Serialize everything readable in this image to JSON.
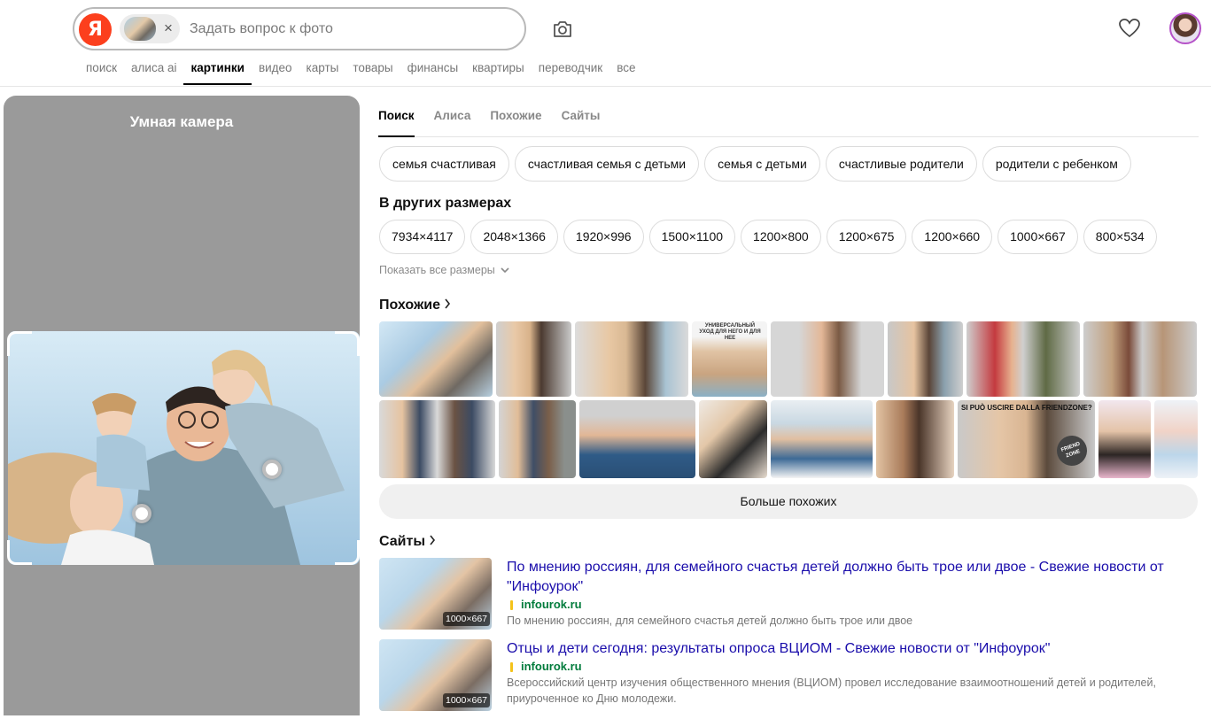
{
  "header": {
    "logo": "Я",
    "search_placeholder": "Задать вопрос к фото",
    "close_glyph": "×"
  },
  "nav": {
    "items": [
      "поиск",
      "алиса ai",
      "картинки",
      "видео",
      "карты",
      "товары",
      "финансы",
      "квартиры",
      "переводчик",
      "все"
    ],
    "active_index": 2
  },
  "camera": {
    "title": "Умная камера"
  },
  "tabs": {
    "items": [
      "Поиск",
      "Алиса",
      "Похожие",
      "Сайты"
    ],
    "active_index": 0
  },
  "chips": [
    "семья счастливая",
    "счастливая семья с детьми",
    "семья с детьми",
    "счастливые родители",
    "родители с ребенком"
  ],
  "sizes": {
    "title": "В других размерах",
    "items": [
      "7934×4117",
      "2048×1366",
      "1920×996",
      "1500×1100",
      "1200×800",
      "1200×675",
      "1200×660",
      "1000×667",
      "800×534"
    ],
    "show_all": "Показать все размеры"
  },
  "similar": {
    "title": "Похожие",
    "more_button": "Больше похожих",
    "banner_text_1": "УНИВЕРСАЛЬНЫЙ УХОД ДЛЯ НЕГО И ДЛЯ НЕЕ",
    "banner_text_2": "SI PUÒ USCIRE DALLA FRIENDZONE?",
    "banner_text_3": "FRIEND ZONE"
  },
  "sites": {
    "title": "Сайты",
    "items": [
      {
        "title": "По мнению россиян, для семейного счастья детей должно быть трое или двое - Свежие новости от \"Инфоурок\"",
        "domain": "infourok.ru",
        "description": "По мнению россиян, для семейного счастья детей должно быть трое или двое",
        "size": "1000×667"
      },
      {
        "title": "Отцы и дети сегодня: результаты опроса ВЦИОМ - Свежие новости от \"Инфоурок\"",
        "domain": "infourok.ru",
        "description": "Всероссийский центр изучения общественного мнения (ВЦИОМ) провел исследование взаимоотношений детей и родителей, приуроченное ко Дню молодежи.",
        "size": "1000×667"
      }
    ]
  },
  "colors": {
    "brand": "#fc3f1d",
    "link": "#1a0dab",
    "domain": "#007b3b",
    "panel_bg": "#9a9a9a"
  }
}
